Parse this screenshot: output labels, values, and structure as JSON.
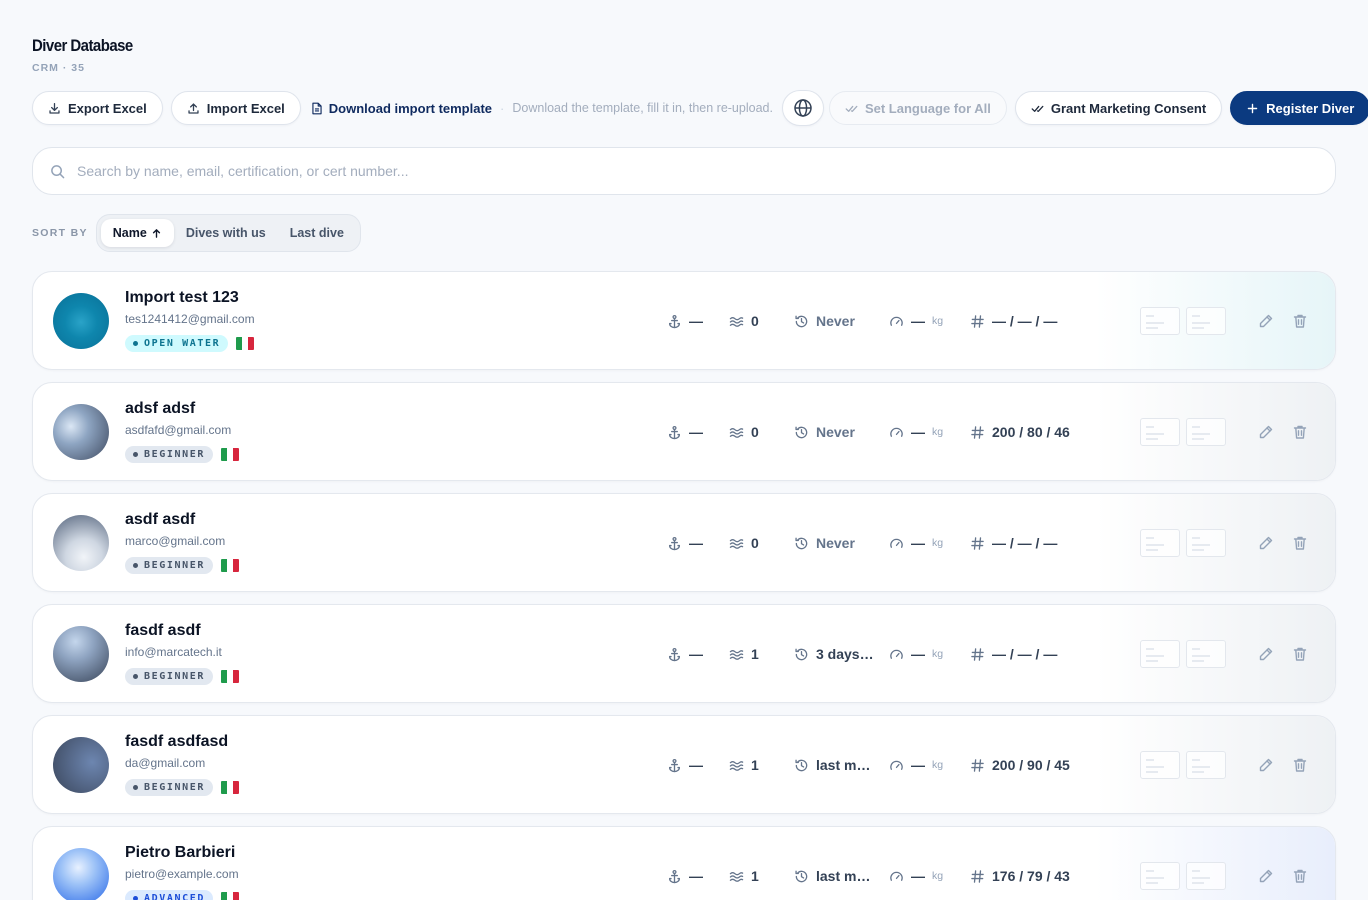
{
  "header": {
    "title": "Diver Database",
    "subtitle": "CRM · 35"
  },
  "toolbar": {
    "export_label": "Export Excel",
    "import_label": "Import Excel",
    "template_label": "Download import template",
    "separator": "·",
    "template_hint": "Download the template, fill it in, then re-upload.",
    "set_language_label": "Set Language for All",
    "marketing_label": "Grant Marketing Consent",
    "register_label": "Register Diver"
  },
  "search": {
    "placeholder": "Search by name, email, certification, or cert number..."
  },
  "sort": {
    "label": "SORT BY",
    "options": [
      {
        "label": "Name",
        "active": true
      },
      {
        "label": "Dives with us",
        "active": false
      },
      {
        "label": "Last dive",
        "active": false
      }
    ]
  },
  "colors": {
    "primary": "#0b3a80",
    "open_water_badge_bg": "#cffafe",
    "open_water_badge_text": "#0e7490",
    "beginner_badge_bg": "#e2e8f0",
    "beginner_badge_text": "#475569",
    "advanced_badge_bg": "#dbeafe",
    "advanced_badge_text": "#1d4ed8"
  },
  "icons": [
    "download-icon",
    "upload-icon",
    "file-icon",
    "globe-icon",
    "check-double-icon",
    "plus-icon",
    "search-icon",
    "arrow-up-icon",
    "anchor-icon",
    "waves-icon",
    "history-icon",
    "gauge-icon",
    "hash-icon",
    "pencil-icon",
    "trash-icon"
  ],
  "divers": [
    {
      "name": "Import test 123",
      "email": "tes1241412@gmail.com",
      "level": "OPEN WATER",
      "level_style": "open",
      "country": "IT",
      "anchor": "—",
      "dives": "0",
      "last_dive": "Never",
      "last_dive_muted": true,
      "weight": "—",
      "weight_unit": "kg",
      "sizes": "— / — / —",
      "avatar": "radial-gradient(circle at 50% 52%, #2aa3c8 0%, #0e86ad 40%, #0a6f96 100%)",
      "tint": "#e6f5f8"
    },
    {
      "name": "adsf adsf",
      "email": "asdfafd@gmail.com",
      "level": "BEGINNER",
      "level_style": "beginner",
      "country": "IT",
      "anchor": "—",
      "dives": "0",
      "last_dive": "Never",
      "last_dive_muted": true,
      "weight": "—",
      "weight_unit": "kg",
      "sizes": "200 / 80 / 46",
      "avatar": "radial-gradient(circle at 32% 40%, #dbe7f5 0%, #8ea5c2 35%, #56657d 80%)",
      "tint": "#eef1f4"
    },
    {
      "name": "asdf asdf",
      "email": "marco@gmail.com",
      "level": "BEGINNER",
      "level_style": "beginner",
      "country": "IT",
      "anchor": "—",
      "dives": "0",
      "last_dive": "Never",
      "last_dive_muted": true,
      "weight": "—",
      "weight_unit": "kg",
      "sizes": "— / — / —",
      "avatar": "radial-gradient(circle at 55% 75%, #f1f4f8 0%, #cfd7e2 35%, #6c7a90 85%)",
      "tint": "#eef1f4"
    },
    {
      "name": "fasdf asdf",
      "email": "info@marcatech.it",
      "level": "BEGINNER",
      "level_style": "beginner",
      "country": "IT",
      "anchor": "—",
      "dives": "1",
      "last_dive": "3 days…",
      "last_dive_muted": false,
      "weight": "—",
      "weight_unit": "kg",
      "sizes": "— / — / —",
      "avatar": "radial-gradient(circle at 40% 28%, #c4d6ec 0%, #8ea3c0 35%, #4b596f 85%)",
      "tint": "#eef1f4"
    },
    {
      "name": "fasdf asdfasd",
      "email": "da@gmail.com",
      "level": "BEGINNER",
      "level_style": "beginner",
      "country": "IT",
      "anchor": "—",
      "dives": "1",
      "last_dive": "last m…",
      "last_dive_muted": false,
      "weight": "—",
      "weight_unit": "kg",
      "sizes": "200 / 90 / 45",
      "avatar": "radial-gradient(circle at 70% 45%, #6d86b0 0%, #56698a 45%, #3f4c63 90%)",
      "tint": "#eef1f4"
    },
    {
      "name": "Pietro Barbieri",
      "email": "pietro@example.com",
      "level": "ADVANCED",
      "level_style": "advanced",
      "country": "IT",
      "anchor": "—",
      "dives": "1",
      "last_dive": "last m…",
      "last_dive_muted": false,
      "weight": "—",
      "weight_unit": "kg",
      "sizes": "176 / 79 / 43",
      "avatar": "radial-gradient(circle at 45% 35%, #e8f1ff 0%, #9ec3f7 35%, #2f6de8 95%)",
      "tint": "#e8eefc"
    }
  ]
}
